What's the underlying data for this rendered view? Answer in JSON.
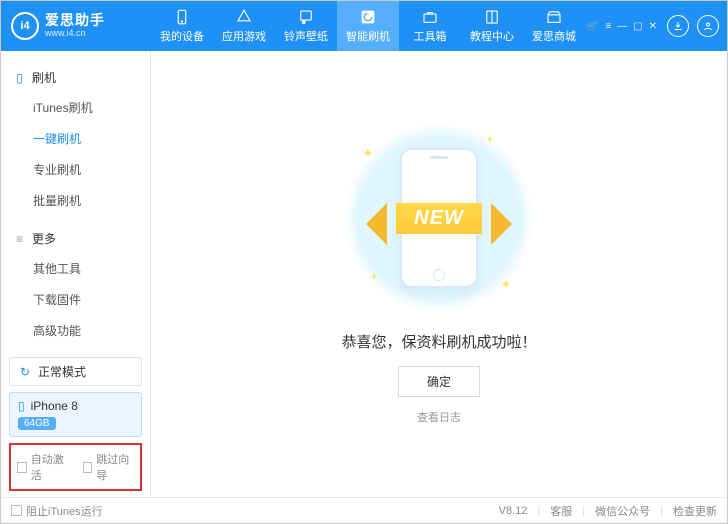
{
  "app": {
    "brand": "爱思助手",
    "brand_sub": "www.i4.cn",
    "logo_letters": "i4"
  },
  "header_tabs": [
    {
      "label": "我的设备",
      "icon": "phone-icon"
    },
    {
      "label": "应用游戏",
      "icon": "apps-icon"
    },
    {
      "label": "铃声壁纸",
      "icon": "music-icon"
    },
    {
      "label": "智能刷机",
      "icon": "refresh-icon",
      "active": true
    },
    {
      "label": "工具箱",
      "icon": "toolbox-icon"
    },
    {
      "label": "教程中心",
      "icon": "book-icon"
    },
    {
      "label": "爱思商城",
      "icon": "store-icon"
    }
  ],
  "sidebar": {
    "sections": [
      {
        "title": "刷机",
        "items": [
          "iTunes刷机",
          "一键刷机",
          "专业刷机",
          "批量刷机"
        ],
        "active_index": 1
      },
      {
        "title": "更多",
        "items": [
          "其他工具",
          "下载固件",
          "高级功能"
        ]
      }
    ],
    "mode_label": "正常模式",
    "device": {
      "name": "iPhone 8",
      "storage": "64GB"
    },
    "opts": {
      "auto_activate": "自动激活",
      "skip_guide": "跳过向导"
    }
  },
  "main": {
    "ribbon_text": "NEW",
    "success": "恭喜您，保资料刷机成功啦！",
    "ok": "确定",
    "view_log": "查看日志"
  },
  "footer": {
    "stop_itunes": "阻止iTunes运行",
    "version": "V8.12",
    "links": [
      "客服",
      "微信公众号",
      "检查更新"
    ]
  }
}
